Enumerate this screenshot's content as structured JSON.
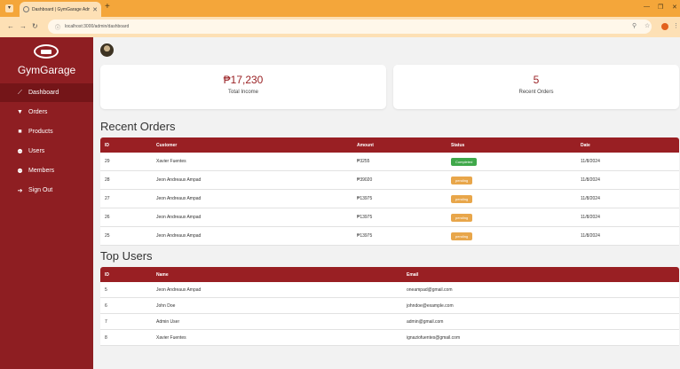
{
  "browser": {
    "tab_title": "Dashboard | GymGarage Admin",
    "url": "localhost:3000/admin/dashboard"
  },
  "sidebar": {
    "brand": "GymGarage",
    "items": [
      {
        "label": "Dashboard",
        "icon": "chart-line-icon"
      },
      {
        "label": "Orders",
        "icon": "cart-icon"
      },
      {
        "label": "Products",
        "icon": "box-icon"
      },
      {
        "label": "Users",
        "icon": "users-icon"
      },
      {
        "label": "Members",
        "icon": "members-icon"
      },
      {
        "label": "Sign Out",
        "icon": "sign-out-icon"
      }
    ]
  },
  "cards": {
    "income": {
      "value": "₱17,230",
      "label": "Total Income"
    },
    "orders": {
      "value": "5",
      "label": "Recent Orders"
    }
  },
  "recent_orders": {
    "title": "Recent Orders",
    "columns": [
      "ID",
      "Customer",
      "Amount",
      "Status",
      "Date"
    ],
    "rows": [
      {
        "id": "29",
        "customer": "Xavier Fuentes",
        "amount": "₱3255",
        "status": "Completed",
        "date": "11/8/2024"
      },
      {
        "id": "28",
        "customer": "Jeon Andreaux Ampad",
        "amount": "₱39020",
        "status": "pending",
        "date": "11/8/2024"
      },
      {
        "id": "27",
        "customer": "Jeon Andreaux Ampad",
        "amount": "₱13975",
        "status": "pending",
        "date": "11/8/2024"
      },
      {
        "id": "26",
        "customer": "Jeon Andreaux Ampad",
        "amount": "₱13975",
        "status": "pending",
        "date": "11/8/2024"
      },
      {
        "id": "25",
        "customer": "Jeon Andreaux Ampad",
        "amount": "₱13975",
        "status": "pending",
        "date": "11/8/2024"
      }
    ]
  },
  "top_users": {
    "title": "Top Users",
    "columns": [
      "ID",
      "Name",
      "Email"
    ],
    "rows": [
      {
        "id": "5",
        "name": "Jeon Andreaux Ampad",
        "email": "oneampad@gmail.com"
      },
      {
        "id": "6",
        "name": "John Doe",
        "email": "johndoe@example.com"
      },
      {
        "id": "7",
        "name": "Admin User",
        "email": "admin@gmail.com"
      },
      {
        "id": "8",
        "name": "Xavier Fuentes",
        "email": "ignaziofuentes@gmail.com"
      }
    ]
  },
  "colors": {
    "sidebar": "#8e1e22",
    "accent": "#991f23",
    "completed": "#3fa84a",
    "pending": "#e8a64a",
    "browser_frame": "#f4a63a"
  }
}
